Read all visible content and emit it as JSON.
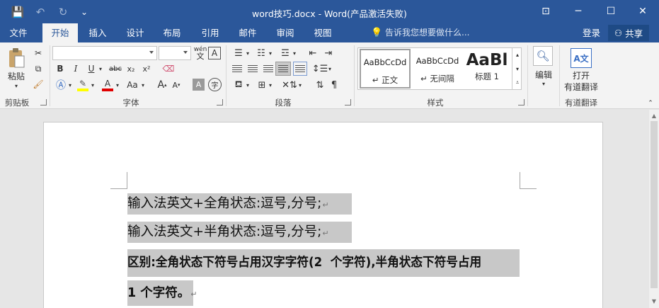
{
  "titlebar": {
    "title": "word技巧.docx - Word(产品激活失败)",
    "qat": {
      "save": "💾",
      "undo": "↶",
      "redo": "↻",
      "customize": "⌄"
    },
    "window": {
      "ribbon_options": "⊡",
      "minimize": "─",
      "maximize": "☐",
      "close": "✕"
    }
  },
  "tabs": [
    "文件",
    "开始",
    "插入",
    "设计",
    "布局",
    "引用",
    "邮件",
    "审阅",
    "视图"
  ],
  "active_tab": "开始",
  "tell_me": "告诉我您想要做什么...",
  "login": "登录",
  "share": "共享",
  "ribbon": {
    "clipboard": {
      "paste": "粘贴",
      "label": "剪贴板"
    },
    "font": {
      "label": "字体",
      "font_name": "",
      "font_size": "",
      "wen": "wén",
      "bold": "B",
      "italic": "I",
      "underline": "U",
      "strike": "abc",
      "subscript": "x₂",
      "superscript": "x²",
      "grow": "A",
      "shrink": "A",
      "case": "Aa",
      "char_shade": "A",
      "enclose": "字"
    },
    "paragraph": {
      "label": "段落"
    },
    "styles": {
      "label": "样式",
      "items": [
        {
          "preview": "AaBbCcDd",
          "name": "↵ 正文"
        },
        {
          "preview": "AaBbCcDd",
          "name": "↵ 无间隔"
        },
        {
          "preview": "AaBl",
          "name": "标题 1"
        }
      ]
    },
    "editing": {
      "label": "编辑"
    },
    "translate": {
      "line1": "打开",
      "line2": "有道翻译",
      "group": "有道翻译"
    }
  },
  "document": {
    "lines": [
      {
        "text": "输入法英文+全角状态:逗号,分号;",
        "bold": false
      },
      {
        "text": "输入法英文+半角状态:逗号,分号;",
        "bold": false
      },
      {
        "text": "区别:全角状态下符号占用汉字字符(2  个字符),半角状态下符号占用",
        "bold": true
      },
      {
        "text": "1 个字符。",
        "bold": true
      }
    ],
    "para_mark": "↵"
  },
  "colors": {
    "brand": "#2b579a",
    "ribbon_bg": "#f3f3f3",
    "highlight_yellow": "#ffff00",
    "font_red": "#e00000",
    "selection": "#c8c8c8"
  }
}
